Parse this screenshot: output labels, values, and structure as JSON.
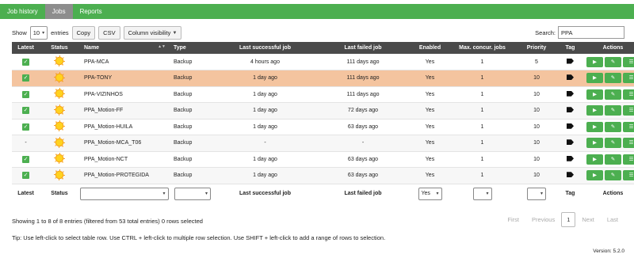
{
  "nav": {
    "tabs": [
      "Job history",
      "Jobs",
      "Reports"
    ]
  },
  "controls": {
    "show_label": "Show",
    "entries_value": "10",
    "entries_label": "entries",
    "copy": "Copy",
    "csv": "CSV",
    "colvis": "Column visibility"
  },
  "search": {
    "label": "Search:",
    "value": "PPA"
  },
  "columns": [
    "Latest",
    "Status",
    "Name",
    "Type",
    "Last successful job",
    "Last failed job",
    "Enabled",
    "Max. concur. jobs",
    "Priority",
    "Tag",
    "Actions"
  ],
  "rows": [
    {
      "latest": "check",
      "name": "PPA-MCA",
      "type": "Backup",
      "last_success": "4 hours ago",
      "last_failed": "111 days ago",
      "enabled": "Yes",
      "max_jobs": "1",
      "priority": "5"
    },
    {
      "latest": "check",
      "name": "PPA-TONY",
      "type": "Backup",
      "last_success": "1 day ago",
      "last_failed": "111 days ago",
      "enabled": "Yes",
      "max_jobs": "1",
      "priority": "10"
    },
    {
      "latest": "check",
      "name": "PPA-VIZINHOS",
      "type": "Backup",
      "last_success": "1 day ago",
      "last_failed": "111 days ago",
      "enabled": "Yes",
      "max_jobs": "1",
      "priority": "10"
    },
    {
      "latest": "check",
      "name": "PPA_Motion-FF",
      "type": "Backup",
      "last_success": "1 day ago",
      "last_failed": "72 days ago",
      "enabled": "Yes",
      "max_jobs": "1",
      "priority": "10"
    },
    {
      "latest": "check",
      "name": "PPA_Motion-HUILA",
      "type": "Backup",
      "last_success": "1 day ago",
      "last_failed": "63 days ago",
      "enabled": "Yes",
      "max_jobs": "1",
      "priority": "10"
    },
    {
      "latest": "-",
      "name": "PPA_Motion-MCA_T06",
      "type": "Backup",
      "last_success": "-",
      "last_failed": "-",
      "enabled": "Yes",
      "max_jobs": "1",
      "priority": "10"
    },
    {
      "latest": "check",
      "name": "PPA_Motion-NCT",
      "type": "Backup",
      "last_success": "1 day ago",
      "last_failed": "63 days ago",
      "enabled": "Yes",
      "max_jobs": "1",
      "priority": "10"
    },
    {
      "latest": "check",
      "name": "PPA_Motion-PROTEGIDA",
      "type": "Backup",
      "last_success": "1 day ago",
      "last_failed": "63 days ago",
      "enabled": "Yes",
      "max_jobs": "1",
      "priority": "10"
    }
  ],
  "footer": {
    "latest": "Latest",
    "status": "Status",
    "last_success": "Last successful job",
    "last_failed": "Last failed job",
    "enabled_value": "Yes",
    "tag": "Tag",
    "actions": "Actions"
  },
  "info": "Showing 1 to 8 of 8 entries (filtered from 53 total entries)   0 rows selected",
  "pager": {
    "first": "First",
    "previous": "Previous",
    "current": "1",
    "next": "Next",
    "last": "Last"
  },
  "tip": "Tip: Use left-click to select table row. Use CTRL + left-click to multiple row selection. Use SHIFT + left-click to add a range of rows to selection.",
  "version": "Version: 5.2.0",
  "colors": {
    "accent": "#4caf50",
    "highlight_row": "#f4c49f",
    "header_bg": "#4a4a4a"
  }
}
